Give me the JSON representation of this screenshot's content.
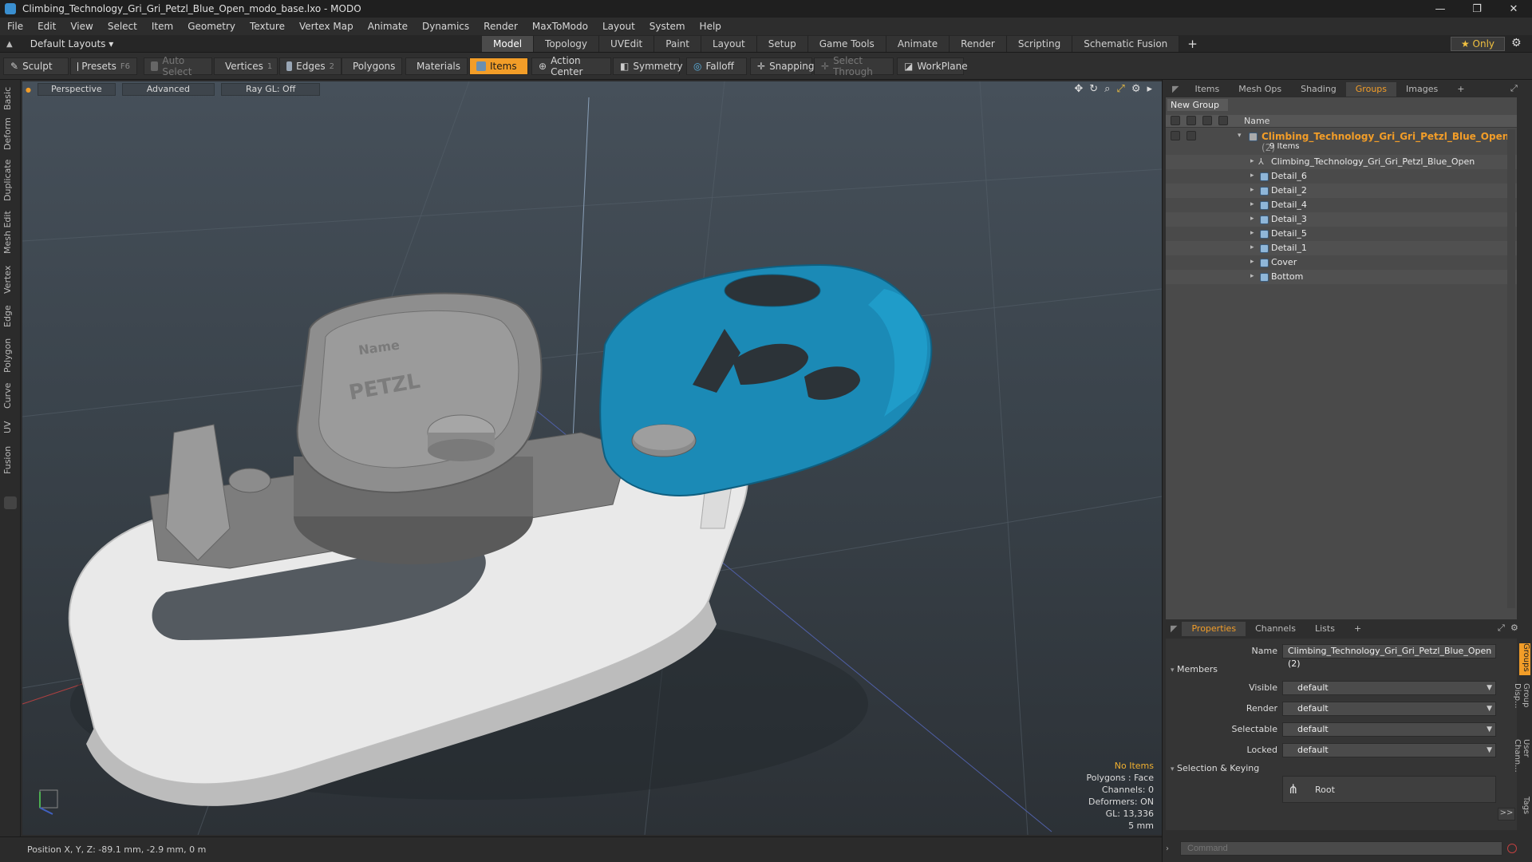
{
  "window": {
    "title": "Climbing_Technology_Gri_Gri_Petzl_Blue_Open_modo_base.lxo - MODO",
    "minimize": "—",
    "restore": "❐",
    "close": "✕"
  },
  "menu": [
    "File",
    "Edit",
    "View",
    "Select",
    "Item",
    "Geometry",
    "Texture",
    "Vertex Map",
    "Animate",
    "Dynamics",
    "Render",
    "MaxToModo",
    "Layout",
    "System",
    "Help"
  ],
  "layout": {
    "selector": "Default Layouts ▾",
    "tabs": [
      "Model",
      "Topology",
      "UVEdit",
      "Paint",
      "Layout",
      "Setup",
      "Game Tools",
      "Animate",
      "Render",
      "Scripting",
      "Schematic Fusion"
    ],
    "active_tab": "Model",
    "add": "+",
    "only": "★ Only",
    "gear": "⚙"
  },
  "toolbar": {
    "sculpt": "Sculpt",
    "presets": "Presets",
    "presets_key": "F6",
    "auto_select": "Auto Select",
    "vertices": "Vertices",
    "vertices_key": "1",
    "edges": "Edges",
    "edges_key": "2",
    "polygons": "Polygons",
    "materials": "Materials",
    "items": "Items",
    "action_center": "Action Center",
    "symmetry": "Symmetry",
    "falloff": "Falloff",
    "snapping": "Snapping",
    "select_through": "Select Through",
    "workplane": "WorkPlane"
  },
  "left_tabs": [
    "Basic",
    "Deform",
    "Duplicate",
    "Mesh Edit",
    "Vertex",
    "Edge",
    "Polygon",
    "Curve",
    "UV",
    "Fusion"
  ],
  "viewport": {
    "view": "Perspective",
    "shading": "Advanced",
    "raygl": "Ray GL: Off",
    "info": {
      "items": "No Items",
      "polygons": "Polygons : Face",
      "channels": "Channels: 0",
      "deformers": "Deformers: ON",
      "gl": "GL: 13,336",
      "scale": "5 mm"
    },
    "logo_text": "PETZL",
    "name_text": "Name"
  },
  "status": {
    "position": "Position X, Y, Z:  -89.1 mm, -2.9 mm, 0 m"
  },
  "right_panel": {
    "tabs": [
      "Items",
      "Mesh Ops",
      "Shading",
      "Groups",
      "Images",
      "+"
    ],
    "active_tab": "Groups",
    "new_group": "New Group",
    "name_header": "Name",
    "group": {
      "name": "Climbing_Technology_Gri_Gri_Petzl_Blue_Open",
      "count": "(2)",
      "items_label": "9 Items"
    },
    "items": [
      "Climbing_Technology_Gri_Gri_Petzl_Blue_Open",
      "Detail_6",
      "Detail_2",
      "Detail_4",
      "Detail_3",
      "Detail_5",
      "Detail_1",
      "Cover",
      "Bottom"
    ]
  },
  "properties": {
    "tabs": [
      "Properties",
      "Channels",
      "Lists",
      "+"
    ],
    "active_tab": "Properties",
    "name_label": "Name",
    "name_value": "Climbing_Technology_Gri_Gri_Petzl_Blue_Open (2)",
    "members_section": "Members",
    "visible_label": "Visible",
    "visible_value": "default",
    "render_label": "Render",
    "render_value": "default",
    "selectable_label": "Selectable",
    "selectable_value": "default",
    "locked_label": "Locked",
    "locked_value": "default",
    "selection_section": "Selection & Keying",
    "root_label": "Root",
    "more": ">>",
    "command_placeholder": "Command",
    "side_tabs": [
      "Groups",
      "Group Disp...",
      "User Chann...",
      "Tags"
    ]
  },
  "colors": {
    "accent": "#f29d28",
    "blue_part": "#1b8ab6",
    "grey_part": "#8a8a8a",
    "white_part": "#e8e8e8"
  }
}
